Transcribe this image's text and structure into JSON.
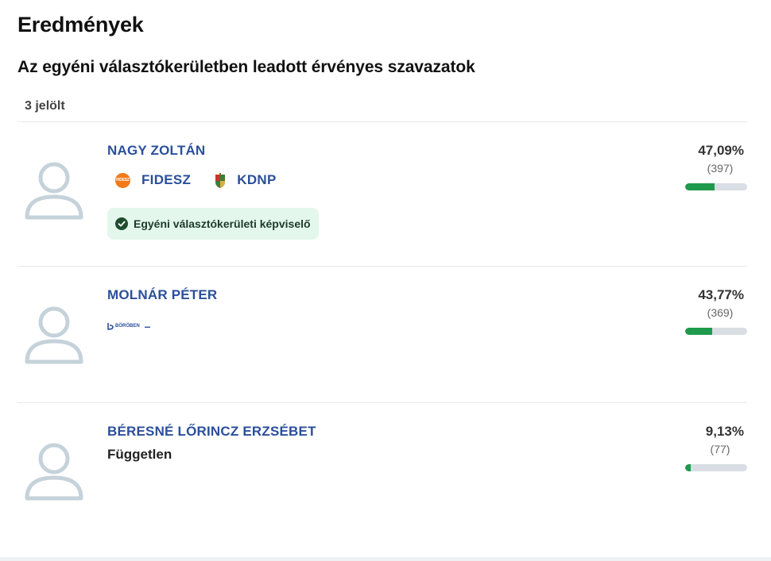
{
  "header": {
    "title": "Eredmények",
    "subtitle": "Az egyéni választókerületben leadott érvényes szavazatok",
    "count_label": "3 jelölt"
  },
  "candidates": [
    {
      "name": "NAGY ZOLTÁN",
      "parties": [
        "FIDESZ",
        "KDNP"
      ],
      "badge": "Egyéni választókerületi képviselő",
      "percent": "47,09%",
      "votes": "(397)",
      "share": 47.09
    },
    {
      "name": "MOLNÁR PÉTER",
      "party_logo_text": "BÖRÖBEN",
      "party_suffix": "–",
      "percent": "43,77%",
      "votes": "(369)",
      "share": 43.77
    },
    {
      "name": "BÉRESNÉ LŐRINCZ ERZSÉBET",
      "affiliation": "Független",
      "percent": "9,13%",
      "votes": "(77)",
      "share": 9.13
    }
  ],
  "colors": {
    "name_link": "#2b4f9b",
    "bar_fill": "#1f9a4c",
    "bar_track": "#d8dee3",
    "badge_bg": "#e3f7ec",
    "fidesz_orange": "#f27a1a"
  }
}
